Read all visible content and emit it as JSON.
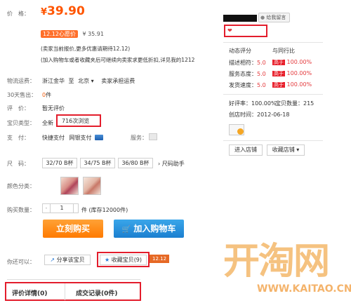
{
  "header": {
    "cut_text": ""
  },
  "price": {
    "label": "价　格：",
    "symbol": "¥",
    "amount": "39.90"
  },
  "promo": {
    "tag": "12.12心愿价",
    "value": "¥ 35.91",
    "note1": "(卖家当前报价,更多优惠请期待12.12)",
    "note2": "(加入购物车或者收藏夹后可继续向卖家求更低折扣,详见我的1212"
  },
  "shipping": {
    "label": "物流运费：",
    "from": "浙江金华",
    "sep": "至",
    "to": "北京",
    "arrow": "▾",
    "policy": "卖家承担运费"
  },
  "sales": {
    "label": "30天售出：",
    "count": "0",
    "unit": "件"
  },
  "review": {
    "label": "评　价：",
    "value": "暂无评价"
  },
  "item_type": {
    "label": "宝贝类型：",
    "value": "全新",
    "views": "716",
    "views_suffix": "次浏览"
  },
  "payment": {
    "label": "支　付：",
    "option1": "快捷支付",
    "option2": "网银支付",
    "service_label": "服务："
  },
  "size": {
    "label": "尺　码：",
    "options": [
      "32/70 B杯",
      "34/75 B杯",
      "36/80 B杯"
    ],
    "helper": "尺码助手"
  },
  "color": {
    "label": "颜色分类："
  },
  "quantity": {
    "label": "购买数量：",
    "minus": "-",
    "value": "1",
    "stock": "件 (库存12000件)"
  },
  "buttons": {
    "buy": "立刻购买",
    "cart": "加入购物车"
  },
  "share": {
    "label": "你还可以：",
    "share_btn": "分享该宝贝",
    "collect_btn": "收藏宝贝",
    "collect_count": "(9)",
    "badge": "12.12"
  },
  "tabs": [
    {
      "label": "评价详情",
      "count": "(0)"
    },
    {
      "label": "成交记录",
      "count": "(0件)"
    }
  ],
  "seller": {
    "leave_msg": "给我留言",
    "rating_title": "动态评分",
    "compare_title": "与同行比",
    "rows": [
      {
        "label": "描述相符：",
        "score": "5.0",
        "tag": "高于",
        "pct": "100.00%"
      },
      {
        "label": "服务态度：",
        "score": "5.0",
        "tag": "高于",
        "pct": "100.00%"
      },
      {
        "label": "发货速度：",
        "score": "5.0",
        "tag": "高于",
        "pct": "100.00%"
      }
    ],
    "good_rate": "好评率：100.00%",
    "item_count": "宝贝数量：215",
    "created": "创店时间：2012-06-18",
    "enter_shop": "进入店铺",
    "collect_shop": "收藏店铺",
    "collect_arrow": "▾"
  },
  "watermark": {
    "logo": "开淘网",
    "url": "WWW.KAITAO.CN"
  },
  "colors": {
    "price": "#ff5500",
    "highlight_box": "#e31d2c",
    "buy": "#ff7a00",
    "cart": "#1b7fd0"
  }
}
